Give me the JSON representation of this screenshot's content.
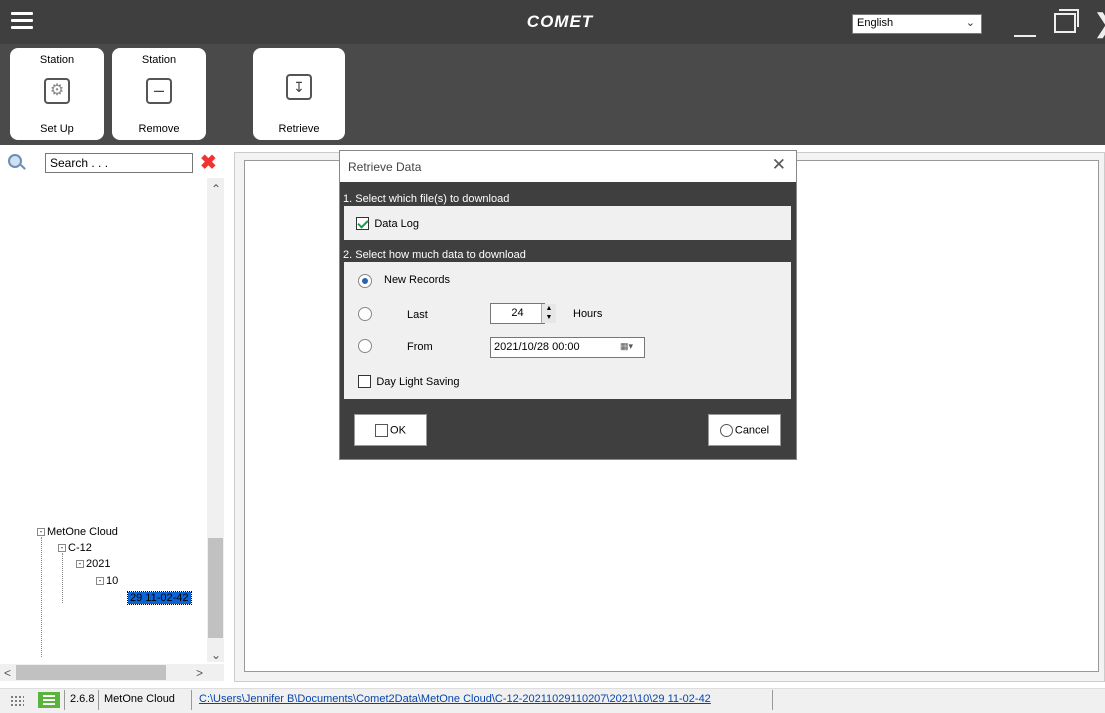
{
  "app": {
    "title": "COMET",
    "language": "English"
  },
  "ribbon": {
    "setup": {
      "top": "Station",
      "bottom": "Set Up"
    },
    "remove": {
      "top": "Station",
      "bottom": "Remove"
    },
    "retrieve": {
      "bottom": "Retrieve"
    }
  },
  "search": {
    "value": "Search . . ."
  },
  "tree": {
    "root": "MetOne Cloud",
    "station": "C-12",
    "year": "2021",
    "month": "10",
    "selected": "29 11-02-42"
  },
  "dialog": {
    "title": "Retrieve Data",
    "section1": "1. Select which file(s) to download",
    "data_log": "Data Log",
    "section2": "2. Select how much data to download",
    "new_records": "New Records",
    "last": "Last",
    "hours_value": "24",
    "hours_unit": "Hours",
    "from": "From",
    "from_date": "2021/10/28 00:00",
    "daylight": "Day Light Saving",
    "ok": "OK",
    "cancel": "Cancel",
    "data_log_checked": true,
    "selected_option": "New Records",
    "daylight_checked": false
  },
  "status": {
    "version": "2.6.8",
    "station": "MetOne Cloud",
    "path": "C:\\Users\\Jennifer B\\Documents\\Comet2Data\\MetOne Cloud\\C-12-20211029110207\\2021\\10\\29 11-02-42"
  },
  "icons": [
    "menu-icon",
    "gear-icon",
    "minus-icon",
    "download-icon",
    "search-icon",
    "clear-icon",
    "close-icon",
    "calendar-icon",
    "grid-icon",
    "list-icon"
  ]
}
